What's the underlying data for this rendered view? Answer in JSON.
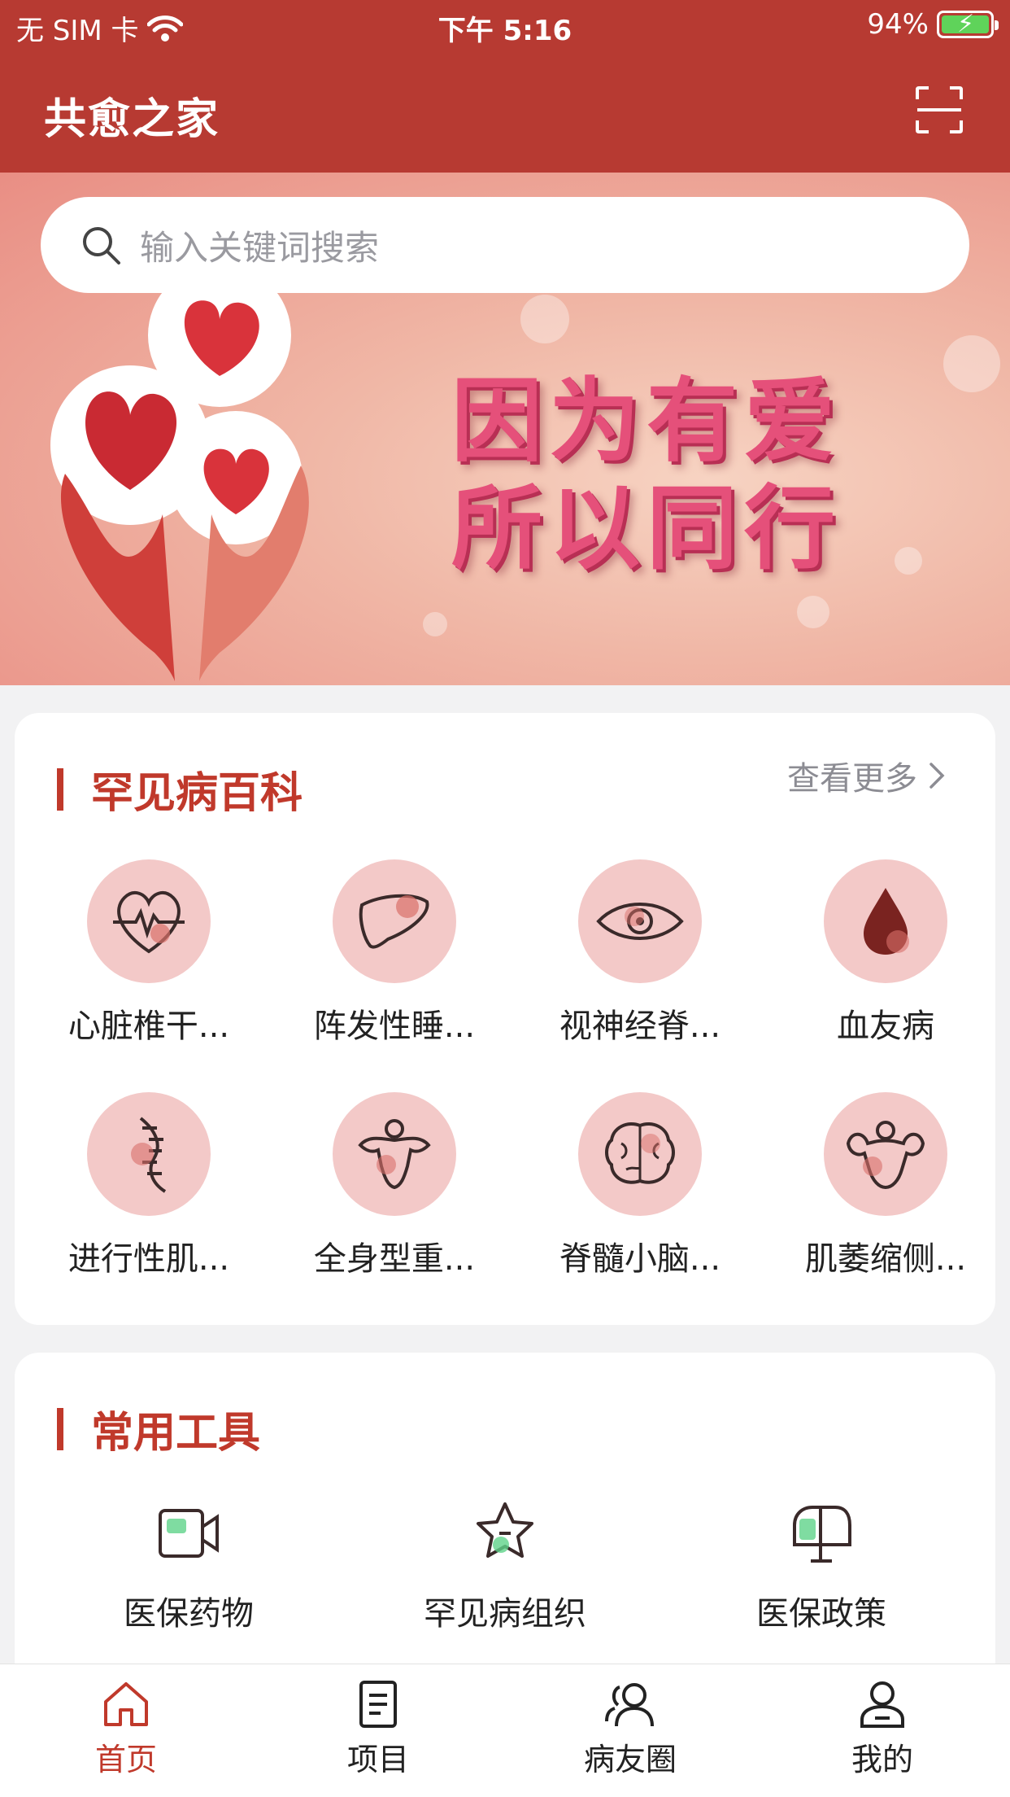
{
  "status_bar": {
    "carrier": "无 SIM 卡",
    "time": "下午 5:16",
    "battery": "94%",
    "battery_level": 0.94
  },
  "header": {
    "title": "共愈之家",
    "scan_icon": "scan-icon"
  },
  "search": {
    "placeholder": "输入关键词搜索",
    "icon": "search-icon"
  },
  "banner": {
    "line1": "因为有爱",
    "line2": "所以同行"
  },
  "rare_disease": {
    "title": "罕见病百科",
    "more_label": "查看更多",
    "items": [
      {
        "label": "心脏椎干...",
        "icon": "heart-pulse-icon"
      },
      {
        "label": "阵发性睡...",
        "icon": "liver-icon"
      },
      {
        "label": "视神经脊...",
        "icon": "eye-icon"
      },
      {
        "label": "血友病",
        "icon": "blood-drop-icon"
      },
      {
        "label": "进行性肌...",
        "icon": "spine-icon"
      },
      {
        "label": "全身型重...",
        "icon": "muscle-body-icon"
      },
      {
        "label": "脊髓小脑...",
        "icon": "brain-icon"
      },
      {
        "label": "肌萎缩侧...",
        "icon": "muscle-torso-icon"
      }
    ]
  },
  "tools": {
    "title": "常用工具",
    "items": [
      {
        "label": "医保药物",
        "icon": "video-icon"
      },
      {
        "label": "罕见病组织",
        "icon": "star-icon"
      },
      {
        "label": "医保政策",
        "icon": "mailbox-icon"
      }
    ]
  },
  "tabbar": {
    "items": [
      {
        "label": "首页",
        "icon": "home-icon",
        "active": true
      },
      {
        "label": "项目",
        "icon": "document-icon",
        "active": false
      },
      {
        "label": "病友圈",
        "icon": "friends-icon",
        "active": false
      },
      {
        "label": "我的",
        "icon": "profile-icon",
        "active": false
      }
    ]
  },
  "colors": {
    "brand": "#b73a32",
    "accent": "#c0392b",
    "icon_bg": "#f3c9c8"
  }
}
